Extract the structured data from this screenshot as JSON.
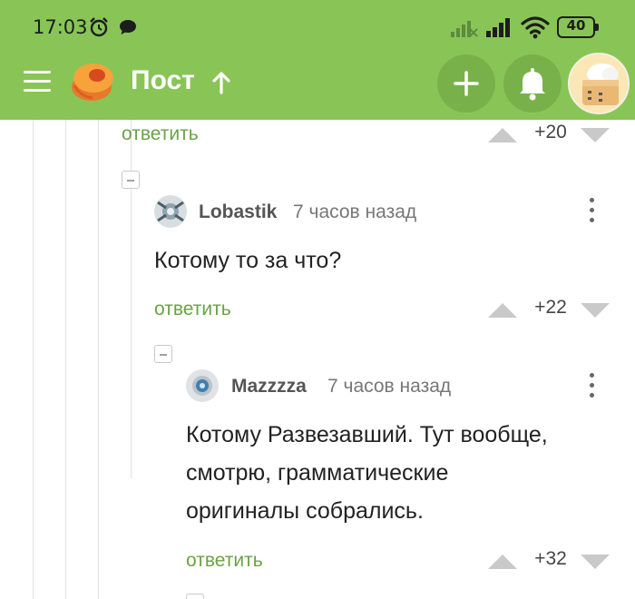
{
  "status_bar": {
    "time": "17:03",
    "battery": "40",
    "icons": [
      "alarm-icon",
      "chat-bubble-icon",
      "signal-icon",
      "signal-icon",
      "wifi-icon",
      "battery-icon"
    ]
  },
  "header": {
    "title": "Пост",
    "icons": [
      "menu-icon",
      "logo",
      "arrow-up-icon",
      "plus-icon",
      "bell-icon",
      "avatar"
    ],
    "colors": {
      "bar": "#88c556",
      "button": "#78b14a"
    }
  },
  "thread": {
    "top": {
      "reply_label": "ответить",
      "score": "+20"
    },
    "comments": [
      {
        "author": "Lobastik",
        "time": "7 часов назад",
        "text_lines": [
          "Котому то за что?"
        ],
        "reply_label": "ответить",
        "score": "+22"
      },
      {
        "author": "Mazzzza",
        "time": "7 часов назад",
        "text_lines": [
          "Котому Развезавший. Тут вообще,",
          "смотрю, грамматические",
          "оригиналы собрались."
        ],
        "reply_label": "ответить",
        "score": "+32"
      }
    ],
    "colors": {
      "reply_link": "#6aa345",
      "vote_arrow": "#c9c9c9"
    }
  }
}
